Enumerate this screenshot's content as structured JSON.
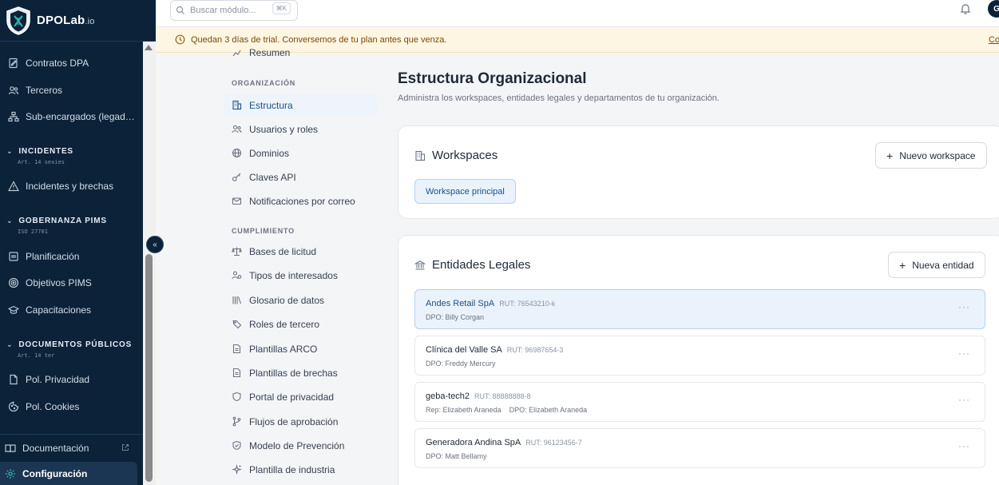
{
  "brand": {
    "name": "DPOLab",
    "suffix": ".io"
  },
  "sidebar": {
    "items": [
      {
        "label": "Contratos DPA",
        "icon": "file-signature-icon"
      },
      {
        "label": "Terceros",
        "icon": "users-icon"
      },
      {
        "label": "Sub-encargados (legad…",
        "icon": "network-icon"
      },
      {
        "label": "Incidentes y brechas",
        "icon": "warning-triangle-icon"
      },
      {
        "label": "Planificación",
        "icon": "clipboard-icon"
      },
      {
        "label": "Objetivos PIMS",
        "icon": "target-icon"
      },
      {
        "label": "Capacitaciones",
        "icon": "graduation-cap-icon"
      },
      {
        "label": "Pol. Privacidad",
        "icon": "file-icon"
      },
      {
        "label": "Pol. Cookies",
        "icon": "cookie-icon"
      }
    ],
    "sections": [
      {
        "label": "INCIDENTES",
        "sub": "Art. 14 sexies"
      },
      {
        "label": "GOBERNANZA PIMS",
        "sub": "ISO 27701"
      },
      {
        "label": "DOCUMENTOS PÚBLICOS",
        "sub": "Art. 14 ter"
      }
    ],
    "footer": {
      "docs_label": "Documentación",
      "config_label": "Configuración"
    },
    "collapse_glyph": "«"
  },
  "topbar": {
    "search_placeholder": "Buscar módulo...",
    "shortcut": "⌘K",
    "avatar_initial": "G"
  },
  "banner": {
    "text": "Quedan 3 días de trial. Conversemos de tu plan antes que venza.",
    "link": "Co"
  },
  "settings_nav": {
    "top_item": "Resumen",
    "org_header": "ORGANIZACIÓN",
    "org_items": [
      {
        "label": "Estructura",
        "icon": "building-icon",
        "active": true
      },
      {
        "label": "Usuarios y roles",
        "icon": "users-icon"
      },
      {
        "label": "Dominios",
        "icon": "globe-icon"
      },
      {
        "label": "Claves API",
        "icon": "key-icon"
      },
      {
        "label": "Notificaciones por correo",
        "icon": "mail-icon"
      }
    ],
    "compliance_header": "CUMPLIMIENTO",
    "compliance_items": [
      {
        "label": "Bases de licitud",
        "icon": "scale-icon"
      },
      {
        "label": "Tipos de interesados",
        "icon": "user-group-icon"
      },
      {
        "label": "Glosario de datos",
        "icon": "library-icon"
      },
      {
        "label": "Roles de tercero",
        "icon": "tags-icon"
      },
      {
        "label": "Plantillas ARCO",
        "icon": "file-text-icon"
      },
      {
        "label": "Plantillas de brechas",
        "icon": "file-text-icon"
      },
      {
        "label": "Portal de privacidad",
        "icon": "shield-icon"
      },
      {
        "label": "Flujos de aprobación",
        "icon": "git-branch-icon"
      },
      {
        "label": "Modelo de Prevención",
        "icon": "shield-check-icon"
      },
      {
        "label": "Plantilla de industria",
        "icon": "sparkles-icon"
      }
    ]
  },
  "main": {
    "title": "Estructura Organizacional",
    "subtitle": "Administra los workspaces, entidades legales y departamentos de tu organización.",
    "workspaces": {
      "title": "Workspaces",
      "button": "Nuevo workspace",
      "chip": "Workspace principal"
    },
    "entities": {
      "title": "Entidades Legales",
      "button": "Nueva entidad",
      "rows": [
        {
          "name": "Andes Retail SpA",
          "rut": "RUT: 76543210-k",
          "detail": "DPO: Billy Corgan",
          "selected": true
        },
        {
          "name": "Clínica del Valle SA",
          "rut": "RUT: 96987654-3",
          "detail": "DPO: Freddy Mercury",
          "selected": false
        },
        {
          "name": "geba-tech2",
          "rut": "RUT: 88888888-8",
          "detail": "Rep: Elizabeth Araneda    DPO: Elizabeth Araneda",
          "selected": false
        },
        {
          "name": "Generadora Andina SpA",
          "rut": "RUT: 96123456-7",
          "detail": "DPO: Matt Bellamy",
          "selected": false
        }
      ],
      "more_glyph": "···"
    }
  }
}
